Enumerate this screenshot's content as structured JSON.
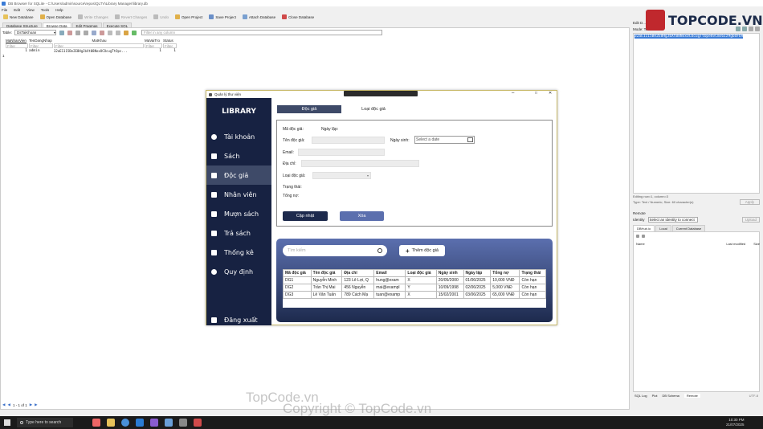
{
  "window_title": "DB Browser for SQLite - C:\\Users\\admin\\source\\repos\\QLTV\\Library Manager\\library.db",
  "menu": [
    "File",
    "Edit",
    "View",
    "Tools",
    "Help"
  ],
  "toolbar": [
    "New Database",
    "Open Database",
    "Write Changes",
    "Revert Changes",
    "Undo",
    "Open Project",
    "Save Project",
    "Attach Database",
    "Close Database"
  ],
  "db_tabs": [
    "Database Structure",
    "Browse Data",
    "Edit Pragmas",
    "Execute SQL"
  ],
  "table_label": "Table:",
  "table_name": "DsTaiKhoan",
  "filter_placeholder": "Filter in any column",
  "grid": {
    "headers": [
      "MaNhanVien",
      "TenDangNhap",
      "MatKhau",
      "MaVaiTro",
      "Status"
    ],
    "filter": "Filter",
    "rows": [
      [
        "1",
        "admin",
        "32aE1115Be2E8HgJbXt08NoxOCOcugTtOps...",
        "1",
        "1"
      ]
    ]
  },
  "pager": "1 - 1 of 1",
  "right_panel": {
    "edit_title": "Edit D...",
    "mode_label": "Mode: Text",
    "cell_text": "32aE1115Be2E8HgJbXt08NoxOCOcugTtOpe8vCms6Iz9g6dFb9",
    "cursor_info": "Editing row=1, column=3",
    "type_info": "Type: Text / Numeric; Size: 60 character(s)",
    "apply": "Apply",
    "remote_title": "Remote",
    "identity_label": "Identity",
    "identity_value": "Select an identity to connect",
    "upload": "Upload",
    "remote_tabs": [
      "DBHub.io",
      "Local",
      "Current Database"
    ],
    "col_name": "Name",
    "col_modified": "Last modified",
    "col_size": "Size",
    "bottom_tabs": [
      "SQL Log",
      "Plot",
      "DB Schema",
      "Remote"
    ],
    "encoding": "UTF-8"
  },
  "app": {
    "title": "Quản lý thư viện",
    "brand": "LIBRARY",
    "nav": [
      "Tài khoản",
      "Sách",
      "Độc giả",
      "Nhân viên",
      "Mượn sách",
      "Trả sách",
      "Thống kê",
      "Quy định"
    ],
    "logout": "Đăng xuất",
    "tabs": [
      "Độc giả",
      "Loại độc giả"
    ],
    "form": {
      "ma": "Mã độc giả:",
      "ngaylap": "Ngày lập:",
      "ten": "Tên độc giả:",
      "ngaysinh": "Ngày sinh:",
      "date_placeholder": "Select a date",
      "email": "Email:",
      "diachi": "Địa chỉ:",
      "loai": "Loại độc giả:",
      "trangthai": "Trạng thái:",
      "tongno": "Tổng nợ:",
      "update": "Cập nhật",
      "delete": "Xóa"
    },
    "search_placeholder": "Tìm kiếm",
    "add_button": "Thêm độc giả",
    "table": {
      "headers": [
        "Mã độc giả",
        "Tên độc giả",
        "Địa chỉ",
        "Email",
        "Loại độc giả",
        "Ngày sinh",
        "Ngày lập",
        "Tổng nợ",
        "Trạng thái"
      ],
      "rows": [
        [
          "DG1",
          "Nguyễn Minh",
          "123 Lê Lợi, Q",
          "hung@exam",
          "X",
          "20/05/2000",
          "01/06/2025",
          "10,000 VNĐ",
          "Còn hạn"
        ],
        [
          "DG2",
          "Trần Thị Mai",
          "456 Nguyễn",
          "mai@exampl",
          "Y",
          "10/09/1998",
          "02/06/2025",
          "5,000 VNĐ",
          "Còn hạn"
        ],
        [
          "DG3",
          "Lê Văn Tuấn",
          "789 Cách Mạ",
          "tuan@examp",
          "X",
          "15/02/2001",
          "03/06/2025",
          "65,000 VNĐ",
          "Còn hạn"
        ]
      ]
    }
  },
  "watermark": {
    "logo": "TOPCODE.VN",
    "line1": "TopCode.vn",
    "line2": "Copyright © TopCode.vn"
  },
  "taskbar": {
    "search": "Type here to search",
    "time": "10:30 PM",
    "date": "21/07/2025"
  },
  "colors": {
    "sidebar": "#172242",
    "accent": "#3e4a68",
    "button": "#5b6fae",
    "dark_button": "#1d2a4d"
  }
}
